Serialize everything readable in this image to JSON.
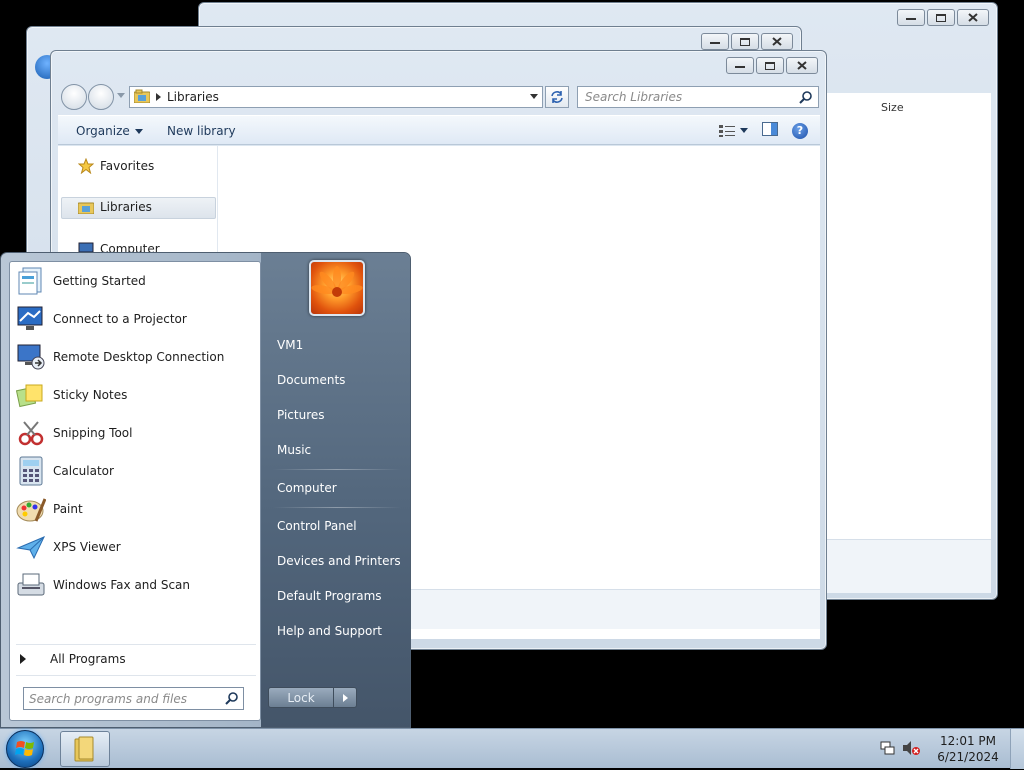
{
  "background_windows": {
    "back_window_header": "Size"
  },
  "explorer": {
    "address_text": "Libraries",
    "search_placeholder": "Search Libraries",
    "toolbar": {
      "organize_label": "Organize",
      "new_library_label": "New library"
    },
    "nav_pane": {
      "favorites_label": "Favorites",
      "libraries_label": "Libraries",
      "computer_label": "Computer"
    }
  },
  "start_menu": {
    "programs": [
      {
        "label": "Getting Started",
        "icon": "getting-started-icon"
      },
      {
        "label": "Connect to a Projector",
        "icon": "projector-icon"
      },
      {
        "label": "Remote Desktop Connection",
        "icon": "remote-desktop-icon"
      },
      {
        "label": "Sticky Notes",
        "icon": "sticky-notes-icon"
      },
      {
        "label": "Snipping Tool",
        "icon": "snipping-tool-icon"
      },
      {
        "label": "Calculator",
        "icon": "calculator-icon"
      },
      {
        "label": "Paint",
        "icon": "paint-icon"
      },
      {
        "label": "XPS Viewer",
        "icon": "xps-viewer-icon"
      },
      {
        "label": "Windows Fax and Scan",
        "icon": "fax-scan-icon"
      }
    ],
    "all_programs_label": "All Programs",
    "search_placeholder": "Search programs and files",
    "right_items": {
      "user": "VM1",
      "documents": "Documents",
      "pictures": "Pictures",
      "music": "Music",
      "computer": "Computer",
      "control_panel": "Control Panel",
      "devices_printers": "Devices and Printers",
      "default_programs": "Default Programs",
      "help_support": "Help and Support"
    },
    "lock_label": "Lock"
  },
  "taskbar": {
    "time": "12:01 PM",
    "date": "6/21/2024"
  },
  "colors": {
    "window_frame": "#cdd9e6",
    "start_right_panel": "#52667c",
    "taskbar": "#b4c6d9",
    "accent_text": "#1e395b"
  }
}
